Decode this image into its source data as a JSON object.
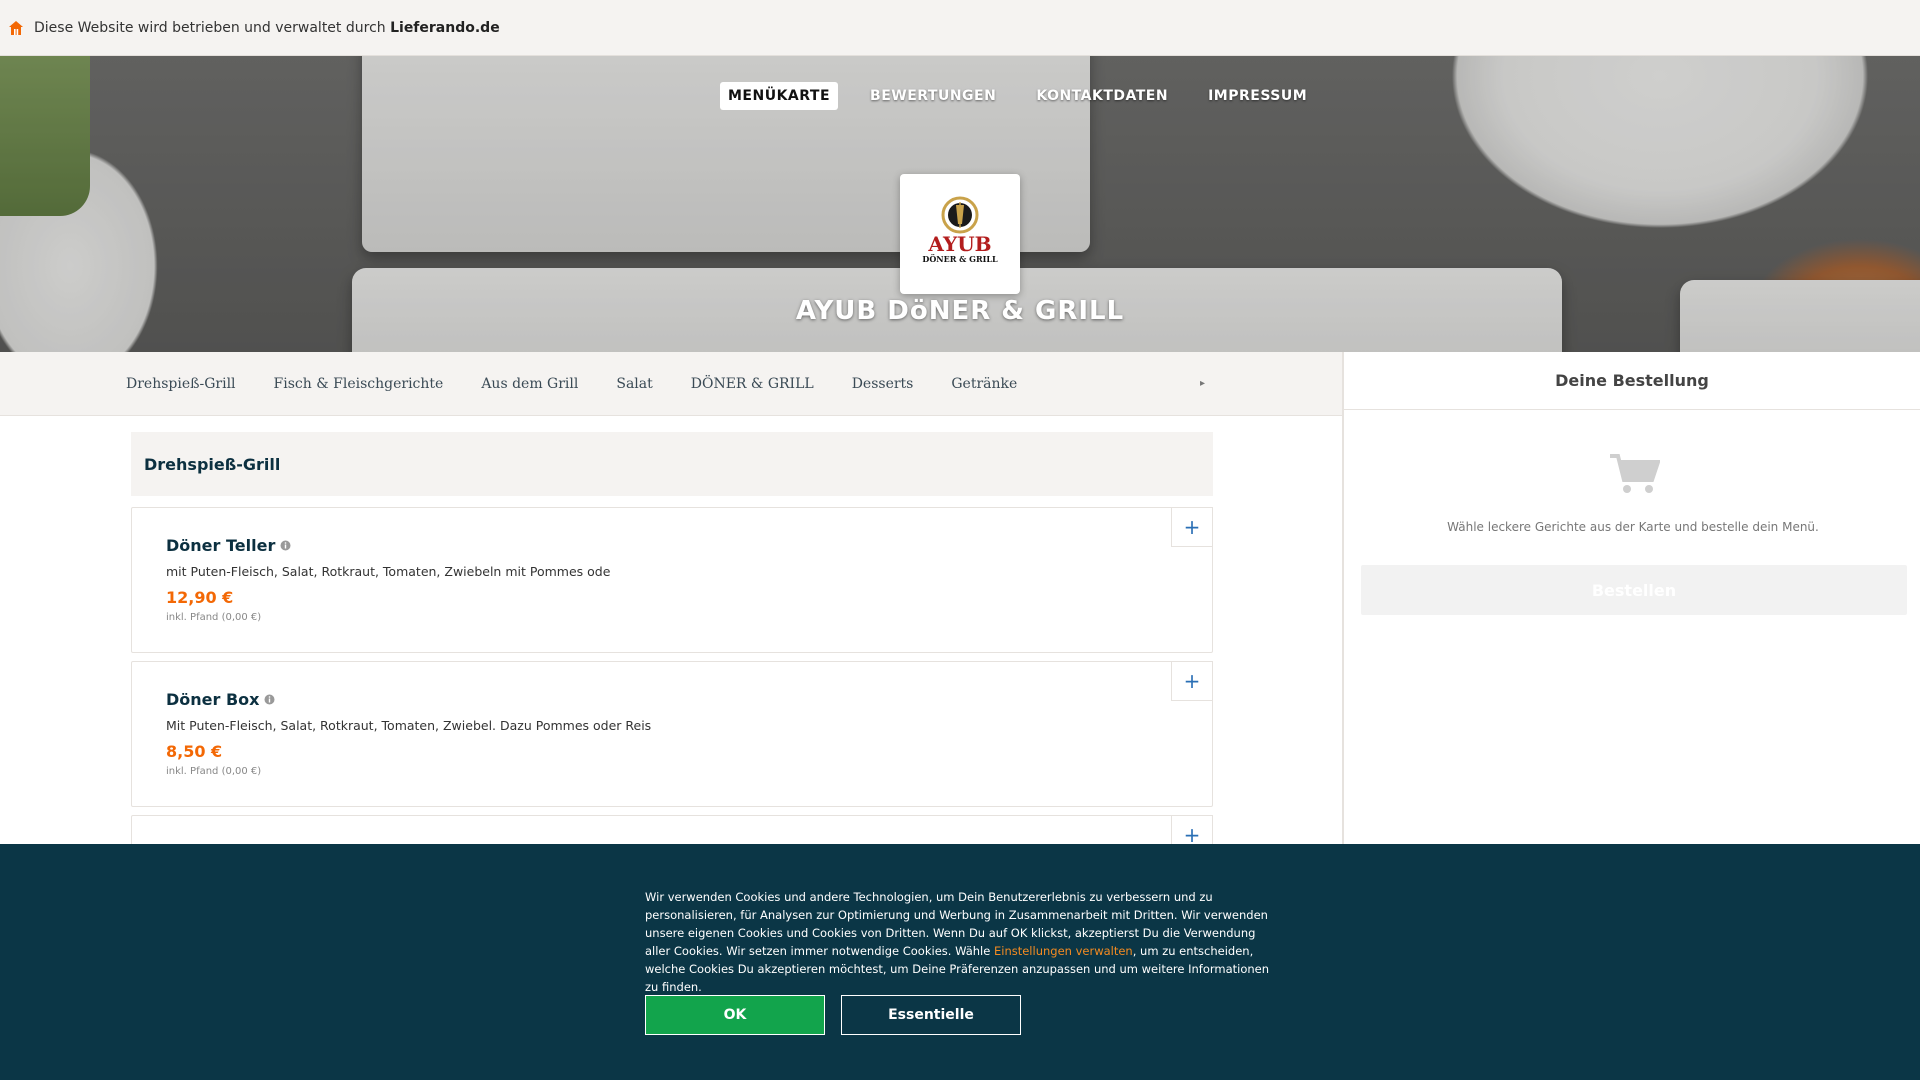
{
  "topbar": {
    "prefix": "Diese Website wird betrieben und verwaltet durch",
    "brand": "Lieferando.de",
    "icon": "home-icon"
  },
  "nav": {
    "items": [
      {
        "label": "MENÜKARTE",
        "active": true
      },
      {
        "label": "BEWERTUNGEN",
        "active": false
      },
      {
        "label": "KONTAKTDATEN",
        "active": false
      },
      {
        "label": "IMPRESSUM",
        "active": false
      }
    ]
  },
  "restaurant": {
    "logo_brand": "AYUB",
    "logo_sub": "DÖNER & GRILL",
    "title": "AYUB DöNER & GRILL"
  },
  "categories": {
    "items": [
      "Drehspieß-Grill",
      "Fisch & Fleischgerichte",
      "Aus dem Grill",
      "Salat",
      "DÖNER & GRILL",
      "Desserts",
      "Getränke"
    ],
    "more_icon": "chevron-right-icon"
  },
  "menu": {
    "section_title": "Drehspieß-Grill",
    "items": [
      {
        "name": "Döner Teller",
        "desc": "mit Puten-Fleisch, Salat, Rotkraut, Tomaten, Zwiebeln mit Pommes ode",
        "price": "12,90 €",
        "deposit": "inkl. Pfand (0,00 €)",
        "add": "+"
      },
      {
        "name": "Döner Box",
        "desc": "Mit Puten-Fleisch, Salat, Rotkraut, Tomaten, Zwiebel. Dazu Pommes oder Reis",
        "price": "8,50 €",
        "deposit": "inkl. Pfand (0,00 €)",
        "add": "+"
      },
      {
        "name": "",
        "desc": "",
        "price": "",
        "deposit": "",
        "add": "+"
      }
    ]
  },
  "order": {
    "title": "Deine Bestellung",
    "hint": "Wähle leckere Gerichte aus der Karte und bestelle dein Menü.",
    "button": "Bestellen",
    "icon": "cart-icon"
  },
  "cookie": {
    "text_before_link": "Wir verwenden Cookies und andere Technologien, um Dein Benutzererlebnis zu verbessern und zu personalisieren, für Analysen zur Optimierung und Werbung in Zusammenarbeit mit Dritten. Wir verwenden unsere eigenen Cookies und Cookies von Dritten. Wenn Du auf OK klickst, akzeptierst Du die Verwendung aller Cookies. Wir setzen immer notwendige Cookies. Wähle ",
    "link": "Einstellungen verwalten",
    "text_after_link": ", um zu entscheiden, welche Cookies Du akzeptieren möchtest, um Deine Präferenzen anzupassen und um weitere Informationen zu finden.",
    "ok": "OK",
    "essential": "Essentielle"
  },
  "colors": {
    "accent": "#f36805",
    "cookie_bg": "#0b3646",
    "ok_green": "#12a44c",
    "link_orange": "#f38b22",
    "heading": "#0c3040"
  }
}
